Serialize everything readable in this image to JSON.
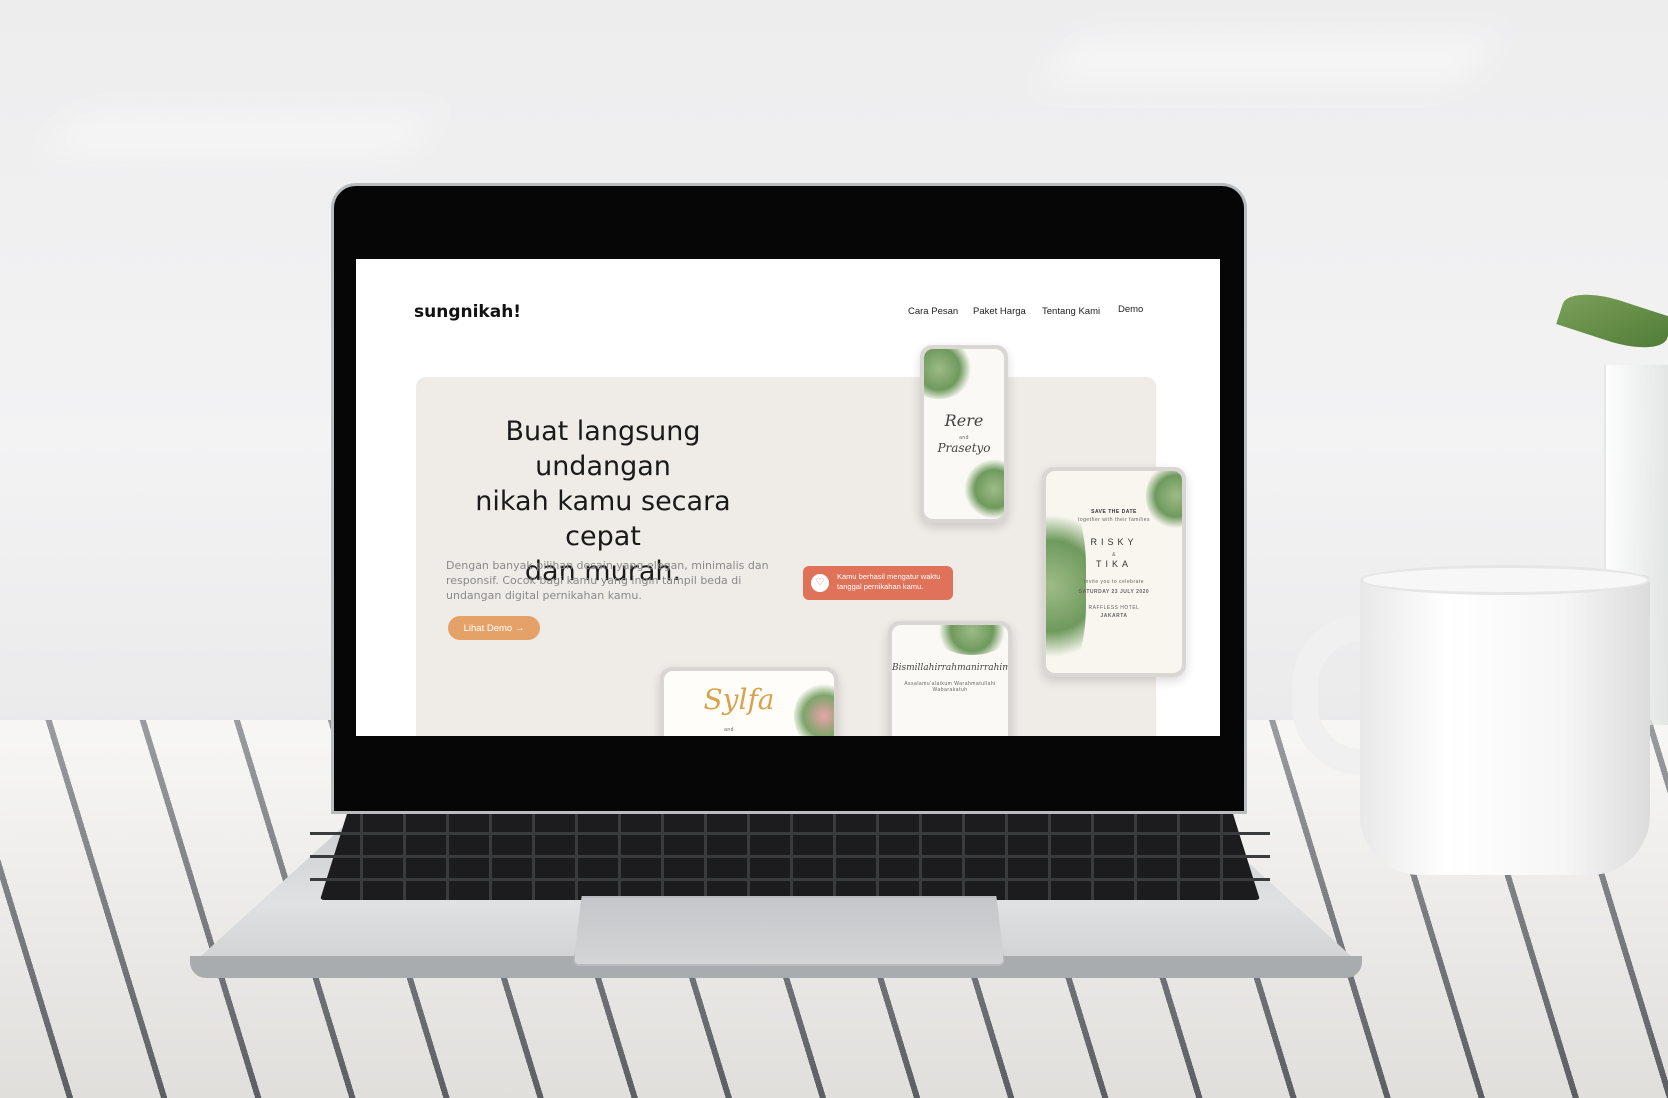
{
  "site": {
    "logo": "sungnikah!",
    "nav": [
      "Cara Pesan",
      "Paket Harga",
      "Tentang Kami",
      "Demo"
    ]
  },
  "hero": {
    "title_line1": "Buat langsung undangan",
    "title_line2": "nikah kamu secara cepat",
    "title_line3": "dan murah.",
    "subtitle_line1": "Dengan banyak pilihan desain yang elegan, minimalis dan",
    "subtitle_line2": "responsif. Cocok bagi kamu yang ingin tampil beda di",
    "subtitle_line3": "undangan digital pernikahan kamu.",
    "cta_label": "Lihat Demo →"
  },
  "toast": {
    "line1": "Kamu berhasil mengatur waktu",
    "line2": "tanggal pernikahan kamu."
  },
  "cards": {
    "card1": {
      "name1": "Rere",
      "and": "and",
      "name2": "Prasetyo"
    },
    "card2": {
      "header": "SAVE THE DATE",
      "subheader": "together with their families",
      "name1": "RISKY",
      "and": "&",
      "name2": "TIKA",
      "invite": "invite you to celebrate",
      "date": "SATURDAY 23 JULY 2020",
      "venue": "RAFFLESS HOTEL",
      "city": "JAKARTA"
    },
    "card3": {
      "title": "Bismillahirrahmanirrahim",
      "body": "Assalamu'alaikum Warahmatullahi Wabarakatuh"
    },
    "card4": {
      "name": "Sylfa",
      "and": "and"
    }
  },
  "icons": {
    "toast": "heart-icon"
  },
  "colors": {
    "cta": "#e5a268",
    "toast": "#e07259",
    "hero_bg": "#efebe7"
  }
}
